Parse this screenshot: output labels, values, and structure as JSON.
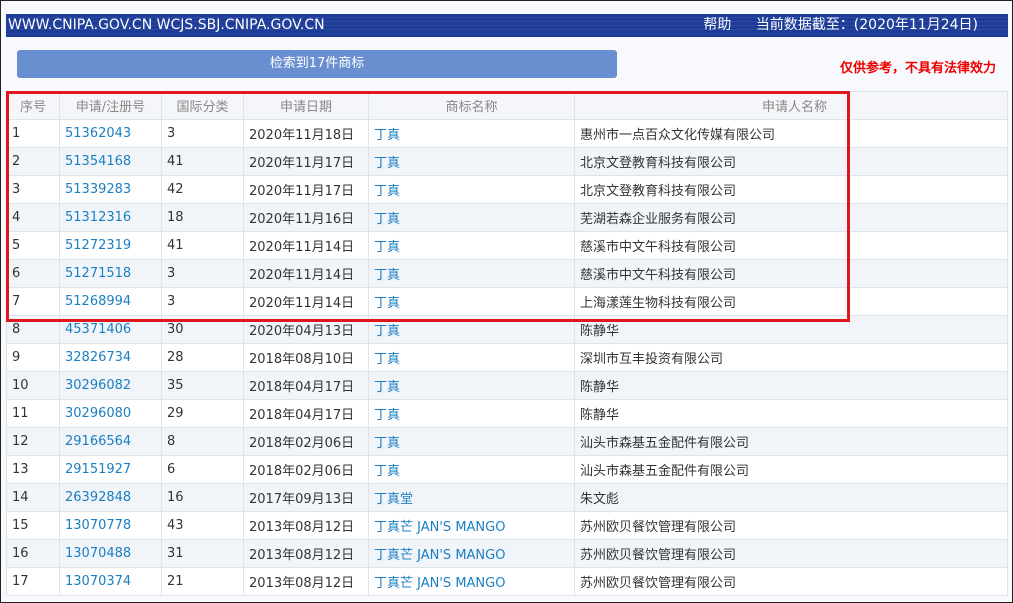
{
  "header": {
    "site": "WWW.CNIPA.GOV.CN WCJS.SBJ.CNIPA.GOV.CN",
    "help": "帮助",
    "data_date": "当前数据截至：(2020年11月24日)"
  },
  "search_result_label": "检索到17件商标",
  "disclaimer": "仅供参考，不具有法律效力",
  "columns": [
    "序号",
    "申请/注册号",
    "国际分类",
    "申请日期",
    "商标名称",
    "申请人名称"
  ],
  "rows": [
    [
      "1",
      "51362043",
      "3",
      "2020年11月18日",
      "丁真",
      "惠州市一点百众文化传媒有限公司"
    ],
    [
      "2",
      "51354168",
      "41",
      "2020年11月17日",
      "丁真",
      "北京文登教育科技有限公司"
    ],
    [
      "3",
      "51339283",
      "42",
      "2020年11月17日",
      "丁真",
      "北京文登教育科技有限公司"
    ],
    [
      "4",
      "51312316",
      "18",
      "2020年11月16日",
      "丁真",
      "芜湖若森企业服务有限公司"
    ],
    [
      "5",
      "51272319",
      "41",
      "2020年11月14日",
      "丁真",
      "慈溪市中文午科技有限公司"
    ],
    [
      "6",
      "51271518",
      "3",
      "2020年11月14日",
      "丁真",
      "慈溪市中文午科技有限公司"
    ],
    [
      "7",
      "51268994",
      "3",
      "2020年11月14日",
      "丁真",
      "上海漾莲生物科技有限公司"
    ],
    [
      "8",
      "45371406",
      "30",
      "2020年04月13日",
      "丁真",
      "陈静华"
    ],
    [
      "9",
      "32826734",
      "28",
      "2018年08月10日",
      "丁真",
      "深圳市互丰投资有限公司"
    ],
    [
      "10",
      "30296082",
      "35",
      "2018年04月17日",
      "丁真",
      "陈静华"
    ],
    [
      "11",
      "30296080",
      "29",
      "2018年04月17日",
      "丁真",
      "陈静华"
    ],
    [
      "12",
      "29166564",
      "8",
      "2018年02月06日",
      "丁真",
      "汕头市森基五金配件有限公司"
    ],
    [
      "13",
      "29151927",
      "6",
      "2018年02月06日",
      "丁真",
      "汕头市森基五金配件有限公司"
    ],
    [
      "14",
      "26392848",
      "16",
      "2017年09月13日",
      "丁真堂",
      "朱文彪"
    ],
    [
      "15",
      "13070778",
      "43",
      "2013年08月12日",
      "丁真芒 JAN'S MANGO",
      "苏州欧贝餐饮管理有限公司"
    ],
    [
      "16",
      "13070488",
      "31",
      "2013年08月12日",
      "丁真芒 JAN'S MANGO",
      "苏州欧贝餐饮管理有限公司"
    ],
    [
      "17",
      "13070374",
      "21",
      "2013年08月12日",
      "丁真芒 JAN'S MANGO",
      "苏州欧贝餐饮管理有限公司"
    ]
  ]
}
